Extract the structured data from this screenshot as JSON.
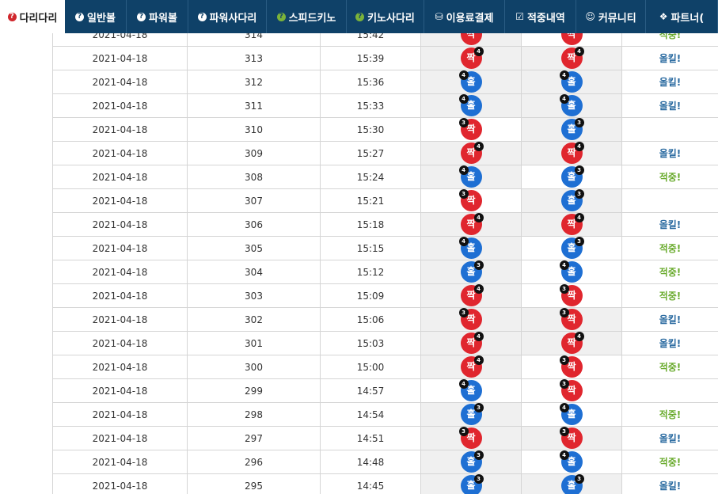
{
  "nav": [
    {
      "label": "다리다리",
      "icon": "question-icon",
      "style": "active"
    },
    {
      "label": "일반볼",
      "icon": "question-icon",
      "style": "blue"
    },
    {
      "label": "파워볼",
      "icon": "question-icon",
      "style": "blue"
    },
    {
      "label": "파워사다리",
      "icon": "question-icon",
      "style": "blue"
    },
    {
      "label": "스피드키노",
      "icon": "question-icon",
      "style": "green"
    },
    {
      "label": "키노사다리",
      "icon": "question-icon",
      "style": "green"
    },
    {
      "label": "이용료결제",
      "icon": "database-icon",
      "style": "plain"
    },
    {
      "label": "적중내역",
      "icon": "checkbox-icon",
      "style": "plain"
    },
    {
      "label": "커뮤니티",
      "icon": "smiley-icon",
      "style": "plain"
    },
    {
      "label": "파트너(",
      "icon": "cubes-icon",
      "style": "plain"
    }
  ],
  "colors": {
    "nav_bg": "#0f4168",
    "red": "#e0262e",
    "blue": "#1e6fd3",
    "hit": "#6aab2e",
    "miss": "#2a6aa0"
  },
  "rows": [
    {
      "date": "2021-04-18",
      "round": "314",
      "time": "15:42",
      "pick": {
        "label": "짝",
        "color": "red",
        "badge": "",
        "side": "r"
      },
      "result": {
        "label": "짝",
        "color": "red",
        "badge": "",
        "side": "r"
      },
      "status": "적중!",
      "status_type": "hit"
    },
    {
      "date": "2021-04-18",
      "round": "313",
      "time": "15:39",
      "pick": {
        "label": "짝",
        "color": "red",
        "badge": "4",
        "side": "r"
      },
      "result": {
        "label": "짝",
        "color": "red",
        "badge": "4",
        "side": "r"
      },
      "status": "올킬!",
      "status_type": "miss"
    },
    {
      "date": "2021-04-18",
      "round": "312",
      "time": "15:36",
      "pick": {
        "label": "홀",
        "color": "blue",
        "badge": "4",
        "side": "l"
      },
      "result": {
        "label": "홀",
        "color": "blue",
        "badge": "4",
        "side": "l"
      },
      "status": "올킬!",
      "status_type": "miss"
    },
    {
      "date": "2021-04-18",
      "round": "311",
      "time": "15:33",
      "pick": {
        "label": "홀",
        "color": "blue",
        "badge": "4",
        "side": "l"
      },
      "result": {
        "label": "홀",
        "color": "blue",
        "badge": "4",
        "side": "l"
      },
      "status": "올킬!",
      "status_type": "miss"
    },
    {
      "date": "2021-04-18",
      "round": "310",
      "time": "15:30",
      "pick": {
        "label": "짝",
        "color": "red",
        "badge": "3",
        "side": "l"
      },
      "result": {
        "label": "홀",
        "color": "blue",
        "badge": "3",
        "side": "r"
      },
      "status": "",
      "status_type": "none"
    },
    {
      "date": "2021-04-18",
      "round": "309",
      "time": "15:27",
      "pick": {
        "label": "짝",
        "color": "red",
        "badge": "4",
        "side": "r"
      },
      "result": {
        "label": "짝",
        "color": "red",
        "badge": "4",
        "side": "r"
      },
      "status": "올킬!",
      "status_type": "miss"
    },
    {
      "date": "2021-04-18",
      "round": "308",
      "time": "15:24",
      "pick": {
        "label": "홀",
        "color": "blue",
        "badge": "4",
        "side": "l"
      },
      "result": {
        "label": "홀",
        "color": "blue",
        "badge": "3",
        "side": "r"
      },
      "status": "적중!",
      "status_type": "hit"
    },
    {
      "date": "2021-04-18",
      "round": "307",
      "time": "15:21",
      "pick": {
        "label": "짝",
        "color": "red",
        "badge": "3",
        "side": "l"
      },
      "result": {
        "label": "홀",
        "color": "blue",
        "badge": "3",
        "side": "r"
      },
      "status": "",
      "status_type": "none"
    },
    {
      "date": "2021-04-18",
      "round": "306",
      "time": "15:18",
      "pick": {
        "label": "짝",
        "color": "red",
        "badge": "4",
        "side": "r"
      },
      "result": {
        "label": "짝",
        "color": "red",
        "badge": "4",
        "side": "r"
      },
      "status": "올킬!",
      "status_type": "miss"
    },
    {
      "date": "2021-04-18",
      "round": "305",
      "time": "15:15",
      "pick": {
        "label": "홀",
        "color": "blue",
        "badge": "4",
        "side": "l"
      },
      "result": {
        "label": "홀",
        "color": "blue",
        "badge": "3",
        "side": "r"
      },
      "status": "적중!",
      "status_type": "hit"
    },
    {
      "date": "2021-04-18",
      "round": "304",
      "time": "15:12",
      "pick": {
        "label": "홀",
        "color": "blue",
        "badge": "3",
        "side": "r"
      },
      "result": {
        "label": "홀",
        "color": "blue",
        "badge": "4",
        "side": "l"
      },
      "status": "적중!",
      "status_type": "hit"
    },
    {
      "date": "2021-04-18",
      "round": "303",
      "time": "15:09",
      "pick": {
        "label": "짝",
        "color": "red",
        "badge": "4",
        "side": "r"
      },
      "result": {
        "label": "짝",
        "color": "red",
        "badge": "3",
        "side": "l"
      },
      "status": "적중!",
      "status_type": "hit"
    },
    {
      "date": "2021-04-18",
      "round": "302",
      "time": "15:06",
      "pick": {
        "label": "짝",
        "color": "red",
        "badge": "3",
        "side": "l"
      },
      "result": {
        "label": "짝",
        "color": "red",
        "badge": "3",
        "side": "l"
      },
      "status": "올킬!",
      "status_type": "miss"
    },
    {
      "date": "2021-04-18",
      "round": "301",
      "time": "15:03",
      "pick": {
        "label": "짝",
        "color": "red",
        "badge": "4",
        "side": "r"
      },
      "result": {
        "label": "짝",
        "color": "red",
        "badge": "4",
        "side": "r"
      },
      "status": "올킬!",
      "status_type": "miss"
    },
    {
      "date": "2021-04-18",
      "round": "300",
      "time": "15:00",
      "pick": {
        "label": "짝",
        "color": "red",
        "badge": "4",
        "side": "r"
      },
      "result": {
        "label": "짝",
        "color": "red",
        "badge": "3",
        "side": "l"
      },
      "status": "적중!",
      "status_type": "hit"
    },
    {
      "date": "2021-04-18",
      "round": "299",
      "time": "14:57",
      "pick": {
        "label": "홀",
        "color": "blue",
        "badge": "4",
        "side": "l"
      },
      "result": {
        "label": "짝",
        "color": "red",
        "badge": "3",
        "side": "l"
      },
      "status": "",
      "status_type": "none"
    },
    {
      "date": "2021-04-18",
      "round": "298",
      "time": "14:54",
      "pick": {
        "label": "홀",
        "color": "blue",
        "badge": "3",
        "side": "r"
      },
      "result": {
        "label": "홀",
        "color": "blue",
        "badge": "4",
        "side": "l"
      },
      "status": "적중!",
      "status_type": "hit"
    },
    {
      "date": "2021-04-18",
      "round": "297",
      "time": "14:51",
      "pick": {
        "label": "짝",
        "color": "red",
        "badge": "3",
        "side": "l"
      },
      "result": {
        "label": "짝",
        "color": "red",
        "badge": "3",
        "side": "l"
      },
      "status": "올킬!",
      "status_type": "miss"
    },
    {
      "date": "2021-04-18",
      "round": "296",
      "time": "14:48",
      "pick": {
        "label": "홀",
        "color": "blue",
        "badge": "3",
        "side": "r"
      },
      "result": {
        "label": "홀",
        "color": "blue",
        "badge": "4",
        "side": "l"
      },
      "status": "적중!",
      "status_type": "hit"
    },
    {
      "date": "2021-04-18",
      "round": "295",
      "time": "14:45",
      "pick": {
        "label": "홀",
        "color": "blue",
        "badge": "3",
        "side": "r"
      },
      "result": {
        "label": "홀",
        "color": "blue",
        "badge": "3",
        "side": "r"
      },
      "status": "올킬!",
      "status_type": "miss"
    }
  ]
}
